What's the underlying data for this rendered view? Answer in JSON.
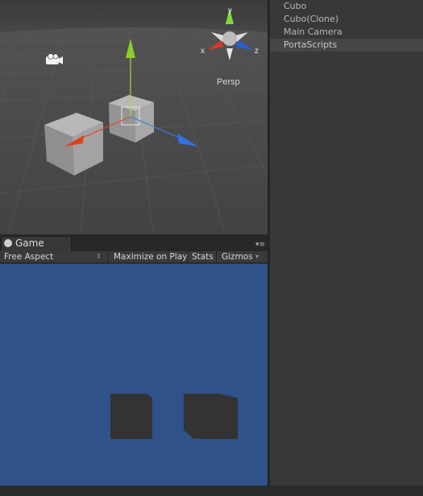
{
  "scene": {
    "persp_label": "Persp",
    "axes": {
      "x": "x",
      "y": "y",
      "z": "z"
    }
  },
  "hierarchy": {
    "items": [
      {
        "label": "Cubo",
        "selected": false
      },
      {
        "label": "Cubo(Clone)",
        "selected": false
      },
      {
        "label": "Main Camera",
        "selected": false
      },
      {
        "label": "PortaScripts",
        "selected": true
      }
    ]
  },
  "game": {
    "tab_label": "Game",
    "aspect_label": "Free Aspect",
    "maximize_label": "Maximize on Play",
    "stats_label": "Stats",
    "gizmos_label": "Gizmos",
    "background_color": "#30528a"
  },
  "icons": [
    "camera-icon",
    "game-tab-icon",
    "tab-menu-icon",
    "dropdown-arrow-icon",
    "orientation-gizmo-icon",
    "move-gizmo-icon"
  ]
}
